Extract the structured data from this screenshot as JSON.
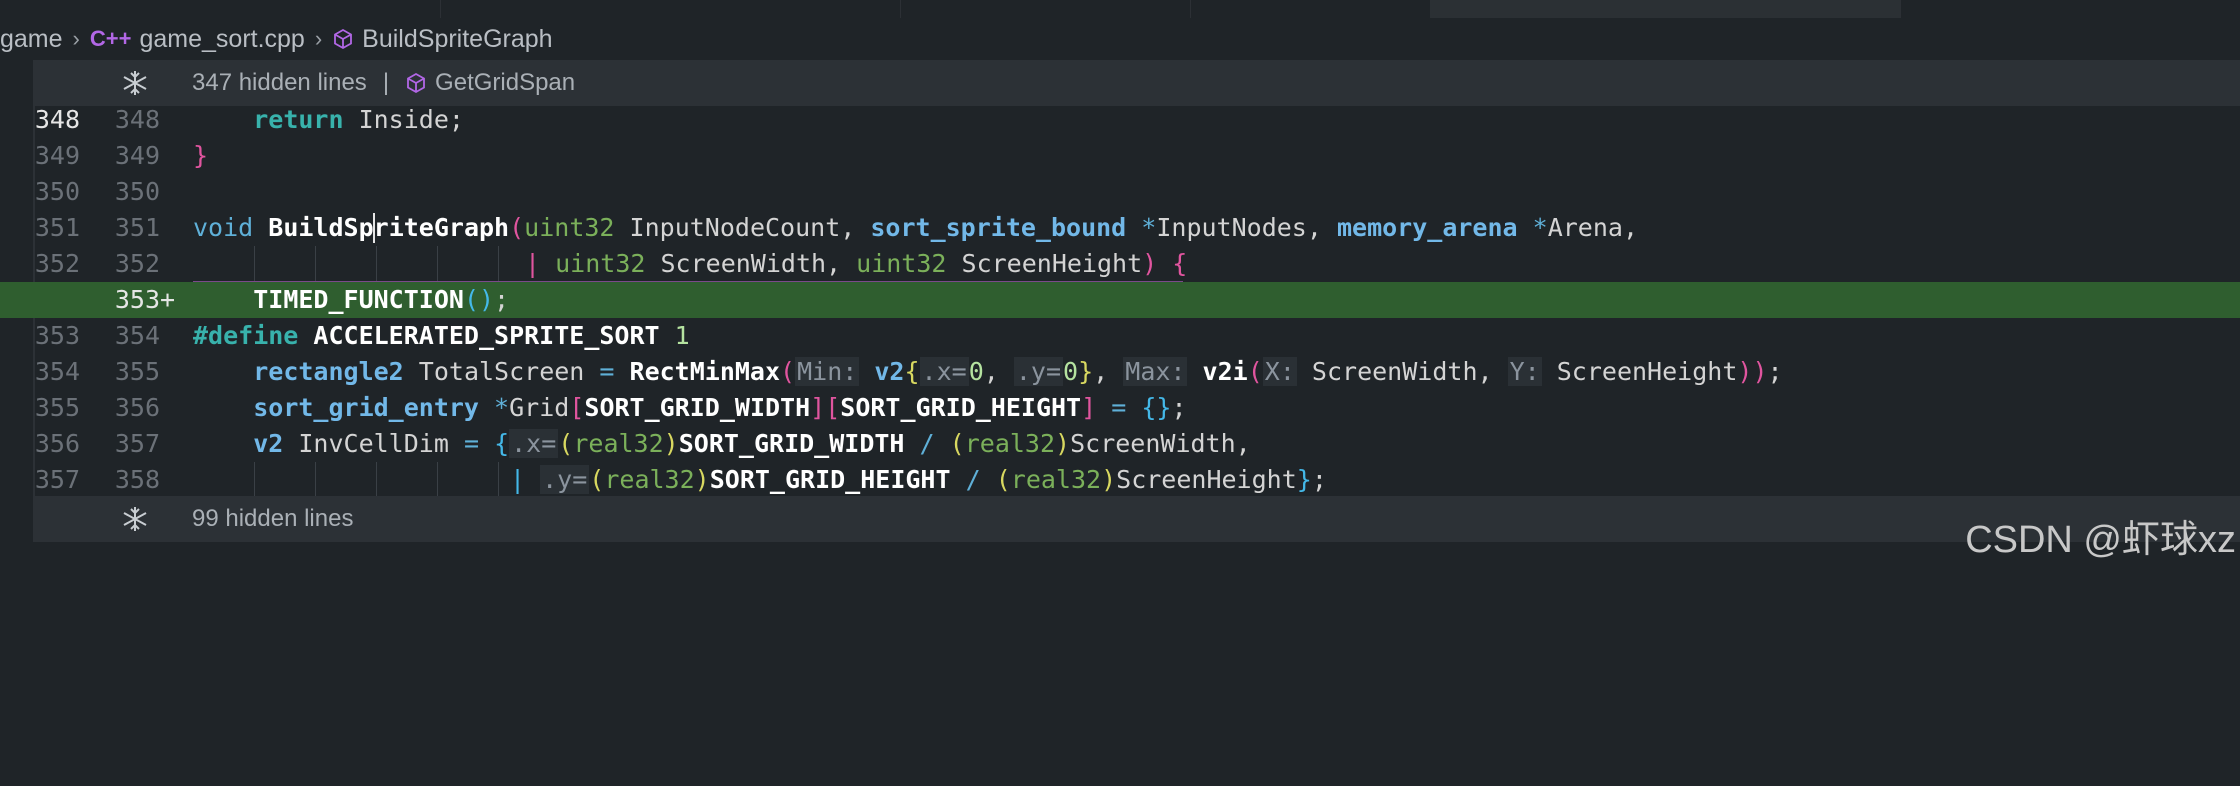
{
  "breadcrumb": {
    "folder": "game",
    "file_icon": "C++",
    "file": "game_sort.cpp",
    "symbol": "BuildSpriteGraph"
  },
  "fold_top": {
    "label": "347 hidden lines",
    "separator": "|",
    "symbol": "GetGridSpan"
  },
  "fold_bottom": {
    "label": "99 hidden lines"
  },
  "lines": [
    {
      "old": "348",
      "new": "348"
    },
    {
      "old": "349",
      "new": "349"
    },
    {
      "old": "350",
      "new": "350"
    },
    {
      "old": "351",
      "new": "351"
    },
    {
      "old": "352",
      "new": "352"
    },
    {
      "old": "",
      "new": "353",
      "added_mark": "+"
    },
    {
      "old": "353",
      "new": "354"
    },
    {
      "old": "354",
      "new": "355"
    },
    {
      "old": "355",
      "new": "356"
    },
    {
      "old": "356",
      "new": "357"
    },
    {
      "old": "357",
      "new": "358"
    }
  ],
  "code": {
    "l348": {
      "kw": "return",
      "rest": " Inside;"
    },
    "l349": {
      "brace": "}"
    },
    "l351": {
      "void": "void",
      "fn": "BuildSpriteGraph",
      "paren": "(",
      "t1": "uint32",
      "a1": " InputNodeCount, ",
      "t2": "sort_sprite_bound",
      "star1": " *",
      "a2": "InputNodes, ",
      "t3": "memory_arena",
      "star2": " *",
      "a3": "Arena,"
    },
    "l352": {
      "t1": "uint32",
      "a1": " ScreenWidth, ",
      "t2": "uint32",
      "a2": " ScreenHeight",
      "close": ")",
      "brace": " {"
    },
    "l353": {
      "mac": "TIMED_FUNCTION",
      "parens": "()",
      "semi": ";"
    },
    "l354": {
      "def": "#define",
      "name": " ACCELERATED_SPRITE_SORT ",
      "val": "1"
    },
    "l355": {
      "t": "rectangle2",
      "var": " TotalScreen ",
      "eq": "=",
      "fn": " RectMinMax",
      "p": "(",
      "h1": "Min:",
      "t2": " v2",
      "b1": "{",
      "h2": ".x=",
      "n1": "0",
      "c1": ", ",
      "h3": ".y=",
      "n2": "0",
      "b2": "}",
      "c2": ", ",
      "h4": "Max:",
      "fn2": " v2i",
      "p2": "(",
      "h5": "X:",
      "a1": " ScreenWidth, ",
      "h6": "Y:",
      "a2": " ScreenHeight",
      "p3": ")",
      "p4": ")",
      "semi": ";"
    },
    "l356": {
      "t": "sort_grid_entry",
      "star": " *",
      "var": "Grid",
      "b1": "[",
      "m1": "SORT_GRID_WIDTH",
      "b2": "][",
      "m2": "SORT_GRID_HEIGHT",
      "b3": "]",
      "eq": " = ",
      "init": "{}",
      "semi": ";"
    },
    "l357": {
      "t": "v2",
      "var": " InvCellDim ",
      "eq": "=",
      "b1": " {",
      "h1": ".x=",
      "p1": "(",
      "t2": "real32",
      "p2": ")",
      "m1": "SORT_GRID_WIDTH",
      "div": " / ",
      "p3": "(",
      "t3": "real32",
      "p4": ")",
      "a1": "ScreenWidth,"
    },
    "l358": {
      "h1": ".y=",
      "p1": "(",
      "t2": "real32",
      "p2": ")",
      "m1": "SORT_GRID_HEIGHT",
      "div": " / ",
      "p3": "(",
      "t3": "real32",
      "p4": ")",
      "a1": "ScreenHeight",
      "b2": "}",
      "semi": ";"
    }
  },
  "watermark": "CSDN @虾球xz",
  "colors": {
    "added_line": "#2f5e2f",
    "background": "#1f2428",
    "fold_bar": "#2c3136"
  },
  "icons": {
    "fold": "fold-expand-icon",
    "symbol": "cube-symbol-icon",
    "breadcrumb_sep": "chevron-right-icon"
  }
}
